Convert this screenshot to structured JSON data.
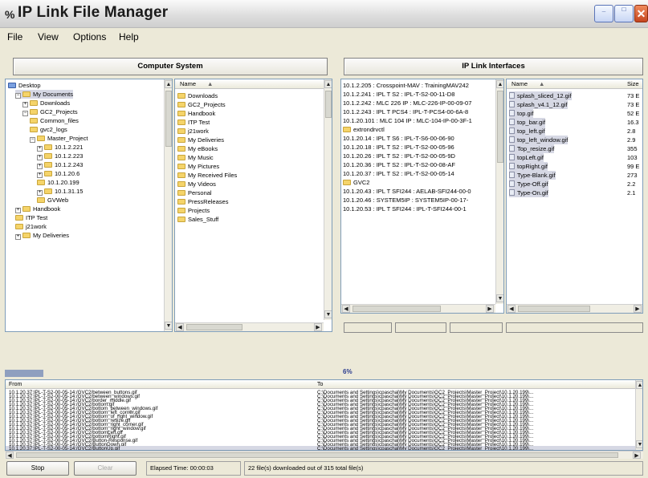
{
  "window": {
    "title": "IP Link File Manager",
    "app_icon": "ip-link-icon"
  },
  "title_buttons": {
    "minimize": "_",
    "maximize": "□",
    "close": "✕"
  },
  "menu": [
    "File",
    "View",
    "Options",
    "Help"
  ],
  "sections": {
    "computer": "Computer System",
    "iplink": "IP Link Interfaces"
  },
  "left_tree": [
    {
      "label": "Desktop",
      "indent": 0,
      "exp": "",
      "icon": "desktop"
    },
    {
      "label": "My Documents",
      "indent": 1,
      "exp": "−",
      "icon": "folder"
    },
    {
      "label": "Downloads",
      "indent": 2,
      "exp": "+",
      "icon": "folder"
    },
    {
      "label": "GC2_Projects",
      "indent": 2,
      "exp": "−",
      "icon": "folder"
    },
    {
      "label": "Common_files",
      "indent": 3,
      "exp": "",
      "icon": "folder"
    },
    {
      "label": "gvc2_logs",
      "indent": 3,
      "exp": "",
      "icon": "folder"
    },
    {
      "label": "Master_Project",
      "indent": 3,
      "exp": "−",
      "icon": "folder"
    },
    {
      "label": "10.1.2.221",
      "indent": 4,
      "exp": "+",
      "icon": "folder"
    },
    {
      "label": "10.1.2.223",
      "indent": 4,
      "exp": "+",
      "icon": "folder"
    },
    {
      "label": "10.1.2.243",
      "indent": 4,
      "exp": "+",
      "icon": "folder"
    },
    {
      "label": "10.1.20.6",
      "indent": 4,
      "exp": "+",
      "icon": "folder"
    },
    {
      "label": "10.1.20.199",
      "indent": 4,
      "exp": "",
      "icon": "folder"
    },
    {
      "label": "10.1.31.15",
      "indent": 4,
      "exp": "+",
      "icon": "folder"
    },
    {
      "label": "GVWeb",
      "indent": 4,
      "exp": "",
      "icon": "folder"
    },
    {
      "label": "Handbook",
      "indent": 1,
      "exp": "+",
      "icon": "folder"
    },
    {
      "label": "ITP Test",
      "indent": 1,
      "exp": "",
      "icon": "folder"
    },
    {
      "label": "j21work",
      "indent": 1,
      "exp": "",
      "icon": "folder"
    },
    {
      "label": "My Deliveries",
      "indent": 1,
      "exp": "+",
      "icon": "folder"
    }
  ],
  "left_list": {
    "header": "Name",
    "sort_icon": "sort-up-icon",
    "items": [
      "Downloads",
      "GC2_Projects",
      "Handbook",
      "ITP Test",
      "j21work",
      "My Deliveries",
      "My eBooks",
      "My Music",
      "My Pictures",
      "My Received Files",
      "My Videos",
      "Personal",
      "PressReleases",
      "Projects",
      "Sales_Stuff"
    ]
  },
  "ip_list": [
    {
      "label": "10.1.2.205 : Crosspoint-MAV : TrainingMAV242",
      "folder": false
    },
    {
      "label": "10.1.2.241 : IPL T S2 : IPL-T-S2-00-11-D8",
      "folder": false
    },
    {
      "label": "10.1.2.242 : MLC 226 IP : MLC-226-IP-00-09-07",
      "folder": false
    },
    {
      "label": "10.1.2.243 : IPL T PCS4 : IPL-T-PCS4-00-6A-8",
      "folder": false
    },
    {
      "label": "10.1.20.101 : MLC 104 IP : MLC-104-IP-00-3F-1",
      "folder": false
    },
    {
      "label": "extrondrvctl",
      "folder": true
    },
    {
      "label": "10.1.20.14 : IPL T S6 : IPL-T-S6-00-06-90",
      "folder": false
    },
    {
      "label": "10.1.20.18 : IPL T S2 : IPL-T-S2-00-05-96",
      "folder": false
    },
    {
      "label": "10.1.20.26 : IPL T S2 : IPL-T-S2-00-05-9D",
      "folder": false
    },
    {
      "label": "10.1.20.36 : IPL T S2 : IPL-T-S2-00-08-AF",
      "folder": false
    },
    {
      "label": "10.1.20.37 : IPL T S2 : IPL-T-S2-00-05-14",
      "folder": false
    },
    {
      "label": "GVC2",
      "folder": true
    },
    {
      "label": "10.1.20.43 : IPL T SFI244 : AELAB-SFI244-00-0",
      "folder": false
    },
    {
      "label": "10.1.20.46 : SYSTEM5IP : SYSTEM5IP-00-17-",
      "folder": false
    },
    {
      "label": "10.1.20.53 : IPL T SFI244 : IPL-T-SFI244-00-1",
      "folder": false
    }
  ],
  "right_files": {
    "headers": {
      "name": "Name",
      "size": "Size"
    },
    "items": [
      {
        "name": "splash_sliced_12.gif",
        "size": "73 E"
      },
      {
        "name": "splash_v4.1_12.gif",
        "size": "73 E"
      },
      {
        "name": "top.gif",
        "size": "52 E"
      },
      {
        "name": "top_bar.gif",
        "size": "16.3"
      },
      {
        "name": "top_left.gif",
        "size": "2.8"
      },
      {
        "name": "top_left_window.gif",
        "size": "2.9"
      },
      {
        "name": "Top_resize.gif",
        "size": "355"
      },
      {
        "name": "topLeft.gif",
        "size": "103"
      },
      {
        "name": "topRight.gif",
        "size": "99 E"
      },
      {
        "name": "Type-Blank.gif",
        "size": "273"
      },
      {
        "name": "Type-Off.gif",
        "size": "2.2"
      },
      {
        "name": "Type-On.gif",
        "size": "2.1"
      }
    ]
  },
  "progress": {
    "percent": 6,
    "label": "6%"
  },
  "downloads": {
    "from_header": "From",
    "to_header": "To",
    "rows": [
      {
        "from": "10.1.20.37:IPL-T-S2-00-05-14:/GVC2/between_buttons.gif",
        "to": "C:\\Documents and Settings\\cpaschal\\My Documents\\GC2_Projects\\Master_Project\\10.1.20.199\\..."
      },
      {
        "from": "10.1.20.37:IPL-T-S2-00-05-14:/GVC2/between_windows.gif",
        "to": "C:\\Documents and Settings\\cpaschal\\My Documents\\GC2_Projects\\Master_Project\\10.1.20.199\\..."
      },
      {
        "from": "10.1.20.37:IPL-T-S2-00-05-14:/GVC2/border_middle.gif",
        "to": "C:\\Documents and Settings\\cpaschal\\My Documents\\GC2_Projects\\Master_Project\\10.1.20.199\\..."
      },
      {
        "from": "10.1.20.37:IPL-T-S2-00-05-14:/GVC2/bottom.gif",
        "to": "C:\\Documents and Settings\\cpaschal\\My Documents\\GC2_Projects\\Master_Project\\10.1.20.199\\..."
      },
      {
        "from": "10.1.20.37:IPL-T-S2-00-05-14:/GVC2/bottom_between_windows.gif",
        "to": "C:\\Documents and Settings\\cpaschal\\My Documents\\GC2_Projects\\Master_Project\\10.1.20.199\\..."
      },
      {
        "from": "10.1.20.37:IPL-T-S2-00-05-14:/GVC2/bottom_left_corner.gif",
        "to": "C:\\Documents and Settings\\cpaschal\\My Documents\\GC2_Projects\\Master_Project\\10.1.20.199\\..."
      },
      {
        "from": "10.1.20.37:IPL-T-S2-00-05-14:/GVC2/bottom_of_right_window.gif",
        "to": "C:\\Documents and Settings\\cpaschal\\My Documents\\GC2_Projects\\Master_Project\\10.1.20.199\\..."
      },
      {
        "from": "10.1.20.37:IPL-T-S2-00-05-14:/GVC2/bottom_resize.gif",
        "to": "C:\\Documents and Settings\\cpaschal\\My Documents\\GC2_Projects\\Master_Project\\10.1.20.199\\..."
      },
      {
        "from": "10.1.20.37:IPL-T-S2-00-05-14:/GVC2/bottom_right_corner.gif",
        "to": "C:\\Documents and Settings\\cpaschal\\My Documents\\GC2_Projects\\Master_Project\\10.1.20.199\\..."
      },
      {
        "from": "10.1.20.37:IPL-T-S2-00-05-14:/GVC2/bottom_right_window.gif",
        "to": "C:\\Documents and Settings\\cpaschal\\My Documents\\GC2_Projects\\Master_Project\\10.1.20.199\\..."
      },
      {
        "from": "10.1.20.37:IPL-T-S2-00-05-14:/GVC2/bottomLeft.gif",
        "to": "C:\\Documents and Settings\\cpaschal\\My Documents\\GC2_Projects\\Master_Project\\10.1.20.199\\..."
      },
      {
        "from": "10.1.20.37:IPL-T-S2-00-05-14:/GVC2/bottomRight.gif",
        "to": "C:\\Documents and Settings\\cpaschal\\My Documents\\GC2_Projects\\Master_Project\\10.1.20.199\\..."
      },
      {
        "from": "10.1.20.37:IPL-T-S2-00-05-14:/GVC2/Button-Response.gif",
        "to": "C:\\Documents and Settings\\cpaschal\\My Documents\\GC2_Projects\\Master_Project\\10.1.20.199\\..."
      },
      {
        "from": "10.1.20.37:IPL-T-S2-00-05-14:/GVC2/ButtonDown.gif",
        "to": "C:\\Documents and Settings\\cpaschal\\My Documents\\GC2_Projects\\Master_Project\\10.1.20.199\\..."
      },
      {
        "from": "10.1.20.37:IPL-T-S2-00-05-14:/GVC2/ButtonUp.gif",
        "to": "C:\\Documents and Settings\\cpaschal\\My Documents\\GC2_Projects\\Master_Project\\10.1.20.199\\..."
      }
    ]
  },
  "status": {
    "stop_label": "Stop",
    "clear_label": "Clear",
    "elapsed_label": "Elapsed Time:",
    "elapsed_value": "00:00:03",
    "summary": "22 file(s) downloaded out of 315 total file(s)"
  },
  "colors": {
    "selection": "#d6d8e4",
    "progress": "#8f9fbf",
    "folder": "#f5d46a"
  }
}
